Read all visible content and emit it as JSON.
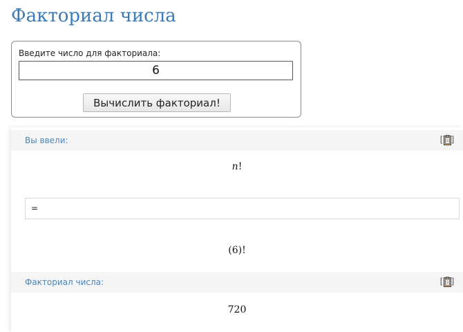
{
  "page": {
    "title": "Факториал числа"
  },
  "calculator": {
    "label": "Введите число для факториала:",
    "input_value": "6",
    "button_label": "Вычислить факториал!"
  },
  "results": {
    "input_section": {
      "title": "Вы ввели:",
      "expression_var": "n",
      "expression_suffix": "!",
      "equals": "=",
      "evaluated_expression": "(6)!"
    },
    "result_section": {
      "title": "Факториал числа:",
      "value": "720"
    },
    "copy_icon": "clipboard-icon"
  },
  "colors": {
    "title": "#3a7ab7",
    "section_title": "#4c86b7",
    "section_bg": "#f5f5f5"
  }
}
